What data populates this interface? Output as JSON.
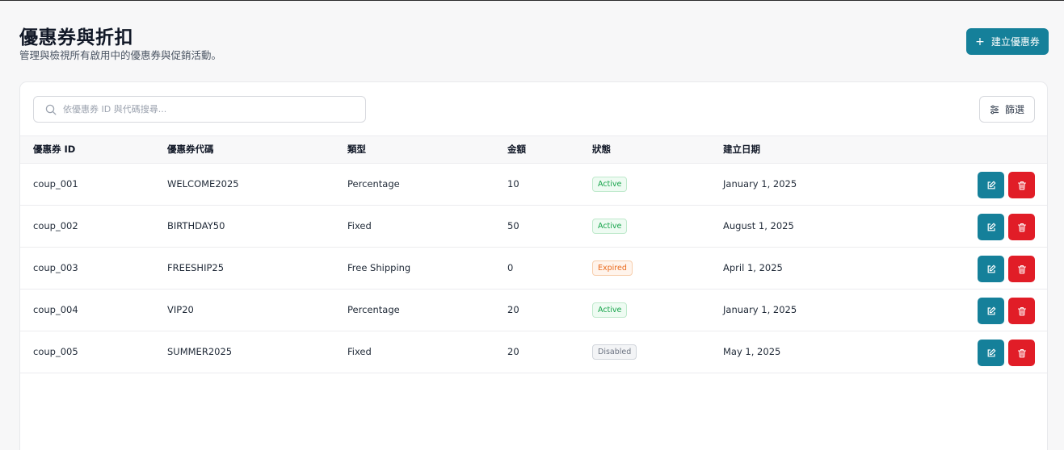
{
  "header": {
    "title": "優惠券與折扣",
    "subtitle": "管理與檢視所有啟用中的優惠券與促銷活動。",
    "create_label": "建立優惠券"
  },
  "toolbar": {
    "search_placeholder": "依優惠券 ID 與代碼搜尋...",
    "filter_label": "篩選"
  },
  "table": {
    "columns": [
      "優惠券 ID",
      "優惠券代碼",
      "類型",
      "金額",
      "狀態",
      "建立日期"
    ],
    "rows": [
      {
        "id": "coup_001",
        "code": "WELCOME2025",
        "type": "Percentage",
        "amount": "10",
        "status": "Active",
        "status_kind": "active",
        "date": "January 1, 2025"
      },
      {
        "id": "coup_002",
        "code": "BIRTHDAY50",
        "type": "Fixed",
        "amount": "50",
        "status": "Active",
        "status_kind": "active",
        "date": "August 1, 2025"
      },
      {
        "id": "coup_003",
        "code": "FREESHIP25",
        "type": "Free Shipping",
        "amount": "0",
        "status": "Expired",
        "status_kind": "expired",
        "date": "April 1, 2025"
      },
      {
        "id": "coup_004",
        "code": "VIP20",
        "type": "Percentage",
        "amount": "20",
        "status": "Active",
        "status_kind": "active",
        "date": "January 1, 2025"
      },
      {
        "id": "coup_005",
        "code": "SUMMER2025",
        "type": "Fixed",
        "amount": "20",
        "status": "Disabled",
        "status_kind": "disabled",
        "date": "May 1, 2025"
      }
    ]
  },
  "icons": {
    "create": "plus-icon",
    "search": "search-icon",
    "filter": "sliders-icon",
    "edit": "edit-icon",
    "delete": "trash-icon"
  },
  "colors": {
    "primary": "#15809a",
    "danger": "#e11d27",
    "active": "#16a34a",
    "expired": "#ea6a1c",
    "disabled": "#6b7280"
  }
}
